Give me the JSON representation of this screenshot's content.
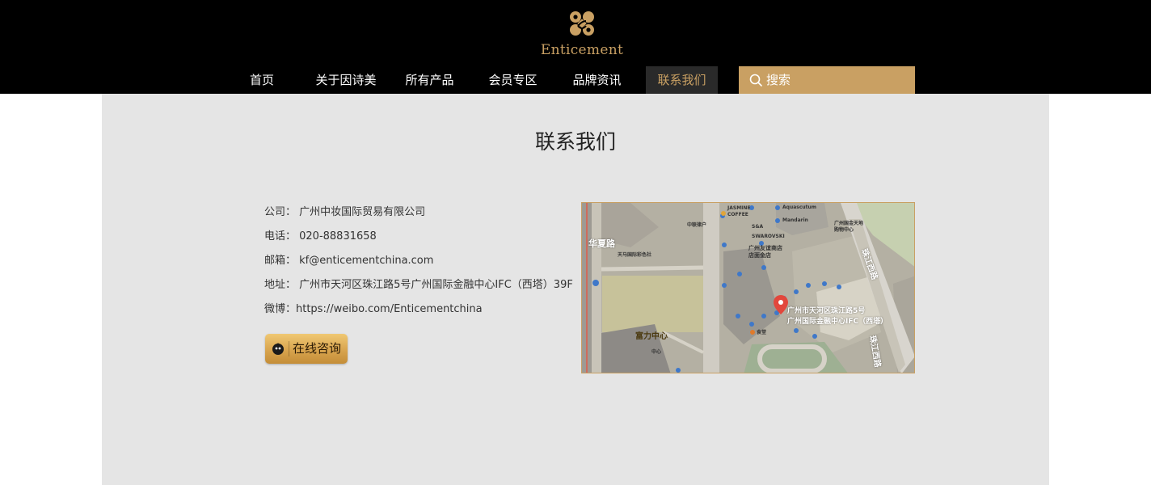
{
  "brand": {
    "name": "Enticement",
    "color": "#c9a063"
  },
  "nav": {
    "items": [
      {
        "label": "首页"
      },
      {
        "label": "关于因诗美"
      },
      {
        "label": "所有产品"
      },
      {
        "label": "会员专区"
      },
      {
        "label": "品牌资讯"
      },
      {
        "label": "联系我们",
        "active": true
      }
    ]
  },
  "search": {
    "placeholder": "搜索",
    "icon": "search-icon"
  },
  "page": {
    "title": "联系我们"
  },
  "contact": {
    "company": "公司：  广州中妆国际贸易有限公司",
    "phone": "电话：  020-88831658",
    "email": "邮箱：  kf@enticementchina.com",
    "address": "地址：  广州市天河区珠江路5号广州国际金融中心IFC（西塔）39F",
    "weibo": "微博：https://weibo.com/Enticementchina"
  },
  "consult_button": {
    "label": "在线咨询",
    "icon": "chat-icon"
  },
  "map": {
    "marker_line1": "广州市天河区珠江路5号",
    "marker_line2": "广州国际金融中心IFC（西塔）",
    "labels": {
      "huaxia": "华夏路",
      "fuli": "富力中心",
      "zhujiang": "珠江西路",
      "zhujiang2": "珠江西路",
      "youyi": "广州友谊商店店面金店",
      "jasmine": "JASMINE COFFEE",
      "sa": "S&A",
      "swarovski": "SWAROVSKI",
      "aquascutum": "Aquascutum",
      "mandarin": "Mandarin",
      "tianma": "天马国际彩色社",
      "zhongke": "中联律户",
      "ifc_center": "广州国金天地购物中心",
      "food": "食堂",
      "center": "中心"
    }
  }
}
